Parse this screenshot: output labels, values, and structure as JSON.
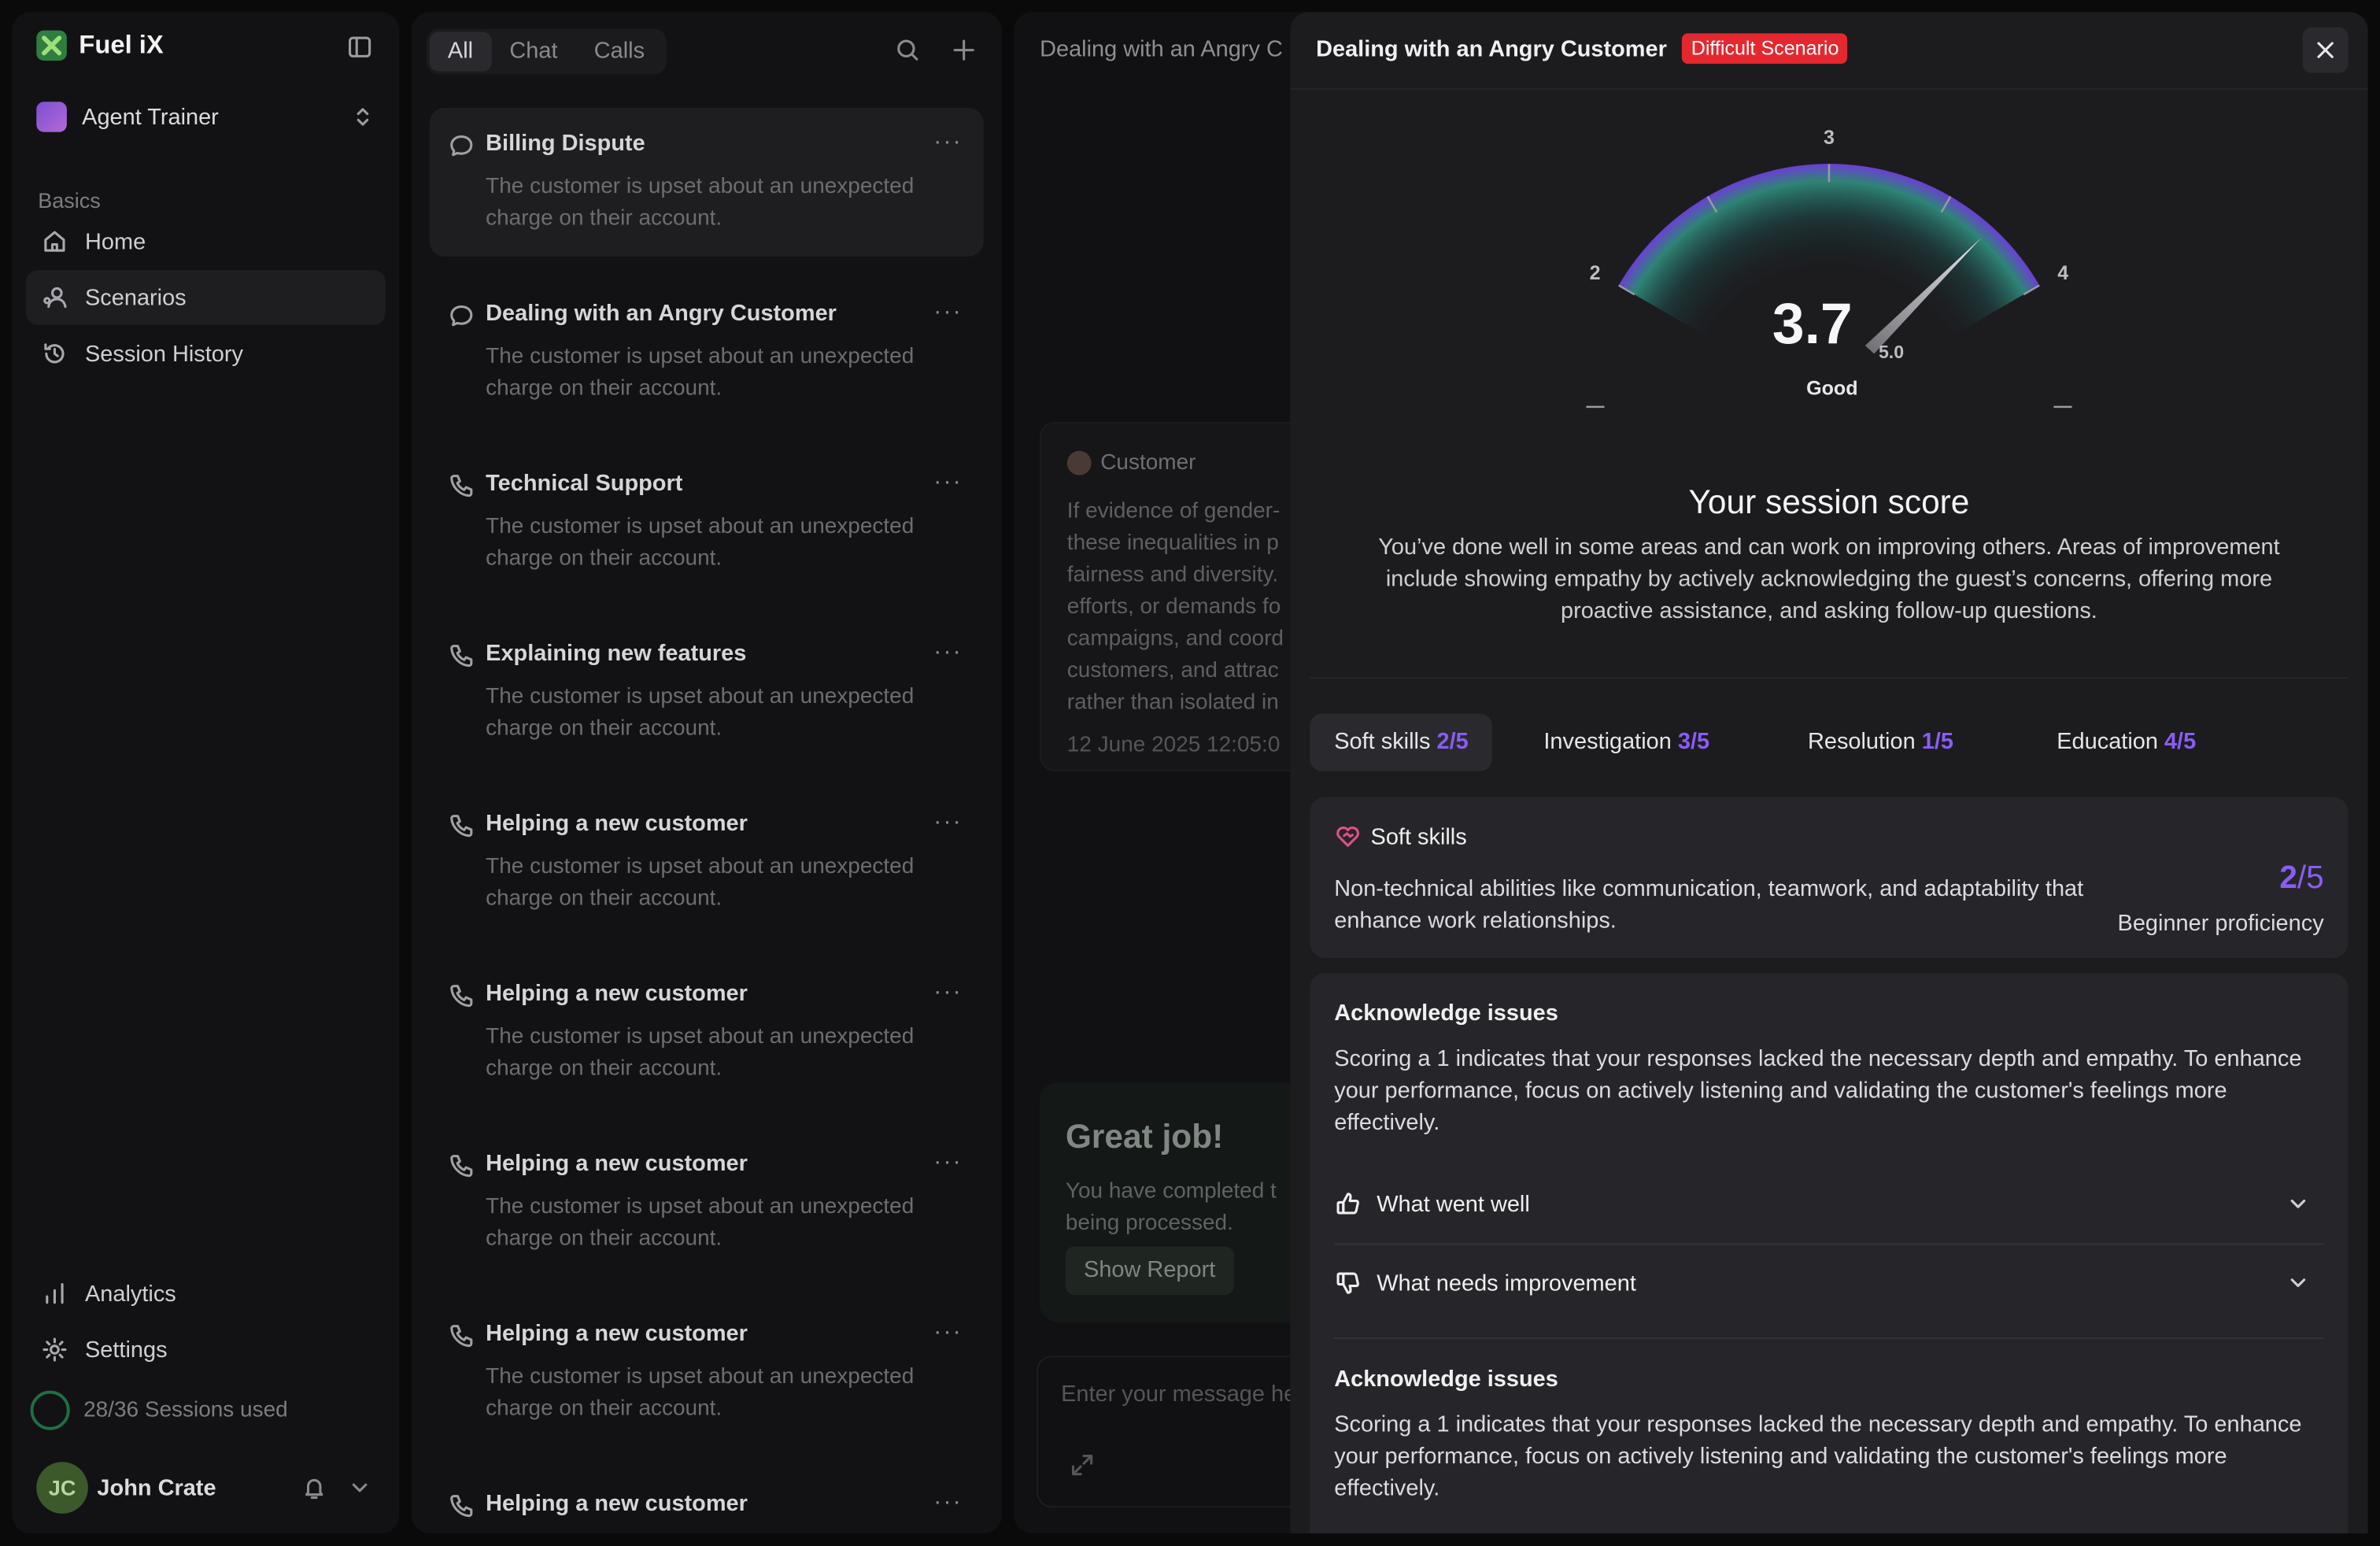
{
  "app": {
    "name": "Fuel iX",
    "agent": "Agent Trainer"
  },
  "sidebar": {
    "section": "Basics",
    "items": [
      {
        "label": "Home",
        "icon": "home-icon"
      },
      {
        "label": "Scenarios",
        "icon": "scenarios-icon",
        "active": true
      },
      {
        "label": "Session History",
        "icon": "history-icon"
      }
    ],
    "bottom_items": [
      {
        "label": "Analytics",
        "icon": "analytics-icon"
      },
      {
        "label": "Settings",
        "icon": "gear-icon"
      }
    ],
    "sessions_used": "28/36 Sessions used",
    "user": {
      "initials": "JC",
      "name": "John Crate"
    }
  },
  "list": {
    "filters": [
      "All",
      "Chat",
      "Calls"
    ],
    "active_filter": "All",
    "cards": [
      {
        "title": "Billing Dispute",
        "desc": "The customer is upset about an unexpected charge on their account.",
        "type": "chat",
        "active": true
      },
      {
        "title": "Dealing with an Angry Customer",
        "desc": "The customer is upset about an unexpected charge on their account.",
        "type": "chat"
      },
      {
        "title": "Technical Support",
        "desc": "The customer is upset about an unexpected charge on their account.",
        "type": "call"
      },
      {
        "title": "Explaining new features",
        "desc": "The customer is upset about an unexpected charge on their account.",
        "type": "call"
      },
      {
        "title": "Helping a new customer",
        "desc": "The customer is upset about an unexpected charge on their account.",
        "type": "call"
      },
      {
        "title": "Helping a new customer",
        "desc": "The customer is upset about an unexpected charge on their account.",
        "type": "call"
      },
      {
        "title": "Helping a new customer",
        "desc": "The customer is upset about an unexpected charge on their account.",
        "type": "call"
      },
      {
        "title": "Helping a new customer",
        "desc": "The customer is upset about an unexpected charge on their account.",
        "type": "call"
      },
      {
        "title": "Helping a new customer",
        "desc": "",
        "type": "call"
      }
    ],
    "more": "···"
  },
  "chat": {
    "title": "Dealing with an Angry C",
    "message": {
      "author": "Customer",
      "lines": [
        "If evidence of gender-",
        "these inequalities in p",
        "fairness and diversity.",
        "efforts, or demands fo",
        "campaigns, and coord",
        "customers, and attrac",
        "rather than isolated in"
      ],
      "time": "12 June 2025 12:05:0"
    },
    "completion": {
      "title": "Great job!",
      "lines": [
        "You have completed t",
        "being processed."
      ],
      "button": "Show Report"
    },
    "input_placeholder": "Enter your message he"
  },
  "report": {
    "title": "Dealing with an Angry Customer",
    "badge": "Difficult Scenario",
    "gauge": {
      "score": "3.7",
      "max": "5.0",
      "rating": "Good",
      "value": 3.7,
      "ticks": [
        "1",
        "2",
        "3",
        "4",
        "5"
      ]
    },
    "score_title": "Your session score",
    "score_text": "You’ve done well in some areas and can work on improving others. Areas of improvement include showing empathy by actively acknowledging the guest’s concerns, offering more proactive assistance, and asking follow-up questions.",
    "tabs": [
      {
        "label": "Soft skills",
        "score": "2/5",
        "active": true
      },
      {
        "label": "Investigation",
        "score": "3/5"
      },
      {
        "label": "Resolution",
        "score": "1/5"
      },
      {
        "label": "Education",
        "score": "4/5"
      }
    ],
    "skill": {
      "name": "Soft skills",
      "desc": "Non-technical abilities like communication, teamwork, and adaptability that enhance work relationships.",
      "score": "2",
      "max": "/5",
      "level": "Beginner proficiency"
    },
    "issues": [
      {
        "title": "Acknowledge issues",
        "text": "Scoring a 1 indicates that your responses lacked the necessary depth and empathy. To enhance your performance, focus on actively listening and validating the customer's feelings more effectively."
      },
      {
        "title": "Acknowledge issues",
        "text": "Scoring a 1 indicates that your responses lacked the necessary depth and empathy. To enhance your performance, focus on actively listening and validating the customer's feelings more effectively."
      }
    ],
    "accordions": [
      "What went well",
      "What needs improvement"
    ]
  },
  "colors": {
    "accent": "#8b5cf6",
    "badge": "#e5282f",
    "brand": "#2f7d3f"
  }
}
